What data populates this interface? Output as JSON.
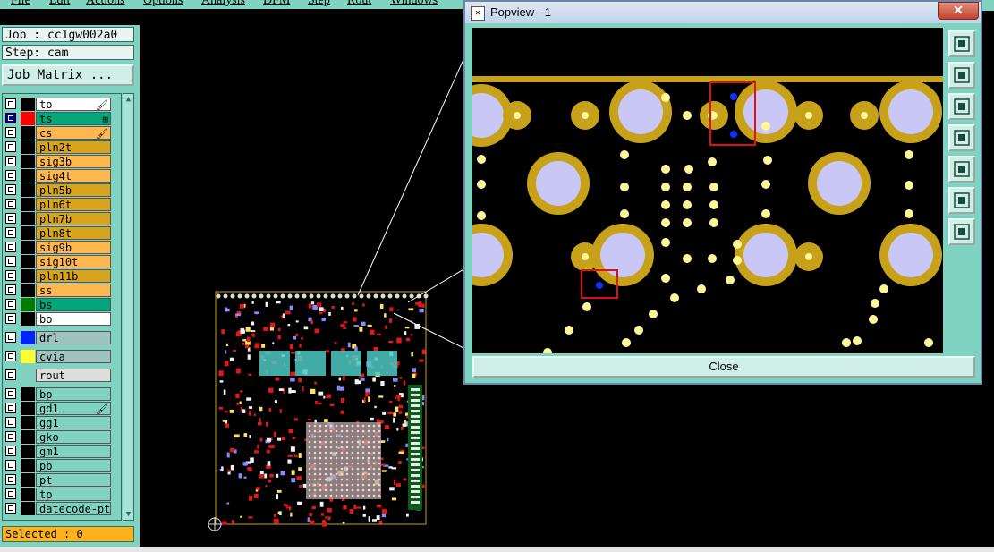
{
  "menu": [
    "File",
    "Edit",
    "Actions",
    "Options",
    "Analysis",
    "DFM",
    "Step",
    "Rout",
    "Windows"
  ],
  "job": {
    "label": "Job : cc1gw002a0",
    "step": "Step: cam",
    "matrix_button": "Job Matrix ..."
  },
  "layers": [
    {
      "name": "to",
      "color": "#ffffff",
      "swatch": "#000000",
      "mark": "🖌"
    },
    {
      "name": "ts",
      "color": "#00a77a",
      "swatch": "#ff0000",
      "checked": true,
      "mark": "⊞"
    },
    {
      "name": "cs",
      "color": "#ffb84d",
      "swatch": "#000000",
      "mark": "🖌"
    },
    {
      "name": "pln2t",
      "color": "#d7a41e",
      "swatch": "#000000"
    },
    {
      "name": "sig3b",
      "color": "#ffb84d",
      "swatch": "#000000"
    },
    {
      "name": "sig4t",
      "color": "#ffb84d",
      "swatch": "#000000"
    },
    {
      "name": "pln5b",
      "color": "#d7a41e",
      "swatch": "#000000"
    },
    {
      "name": "pln6t",
      "color": "#d7a41e",
      "swatch": "#000000"
    },
    {
      "name": "pln7b",
      "color": "#d7a41e",
      "swatch": "#000000"
    },
    {
      "name": "pln8t",
      "color": "#d7a41e",
      "swatch": "#000000"
    },
    {
      "name": "sig9b",
      "color": "#ffb84d",
      "swatch": "#000000"
    },
    {
      "name": "sig10t",
      "color": "#ffb84d",
      "swatch": "#000000"
    },
    {
      "name": "pln11b",
      "color": "#d7a41e",
      "swatch": "#000000"
    },
    {
      "name": "ss",
      "color": "#ffb84d",
      "swatch": "#000000"
    },
    {
      "name": "bs",
      "color": "#00a77a",
      "swatch": "#007a00"
    },
    {
      "name": "bo",
      "color": "#ffffff",
      "swatch": "#000000"
    },
    {
      "name": "drl",
      "color": "#9fc4c0",
      "swatch": "#0022ff",
      "gap": true
    },
    {
      "name": "cvia",
      "color": "#9fc4c0",
      "swatch": "#ffff33",
      "gap": true
    },
    {
      "name": "rout",
      "color": "#dddddd",
      "swatch": "#7fd3c0",
      "gap": true
    },
    {
      "name": "bp",
      "color": "#7fd3c0",
      "swatch": "#000000",
      "gap": true
    },
    {
      "name": "gd1",
      "color": "#7fd3c0",
      "swatch": "#000000",
      "mark": "🖌"
    },
    {
      "name": "gg1",
      "color": "#7fd3c0",
      "swatch": "#000000"
    },
    {
      "name": "gko",
      "color": "#7fd3c0",
      "swatch": "#000000"
    },
    {
      "name": "gm1",
      "color": "#7fd3c0",
      "swatch": "#000000"
    },
    {
      "name": "pb",
      "color": "#7fd3c0",
      "swatch": "#000000"
    },
    {
      "name": "pt",
      "color": "#7fd3c0",
      "swatch": "#000000"
    },
    {
      "name": "tp",
      "color": "#7fd3c0",
      "swatch": "#000000"
    },
    {
      "name": "datecode-pt",
      "color": "#7fd3c0",
      "swatch": "#000000"
    }
  ],
  "selected": "Selected : 0",
  "popup": {
    "title": "Popview - 1",
    "close_label": "Close"
  },
  "colors": {
    "panel": "#7fd3c0",
    "gold": "#c8a11b",
    "pad_fill": "#c9c7f5",
    "via": "#fff89a",
    "highlight": "#e01010",
    "drill": "#1030ff"
  },
  "tool_icons": [
    "zoom-window-icon",
    "pan-up-icon",
    "pan-down-icon",
    "pan-left-icon",
    "pan-right-icon",
    "zoom-fit-icon",
    "zoom-out-icon"
  ]
}
